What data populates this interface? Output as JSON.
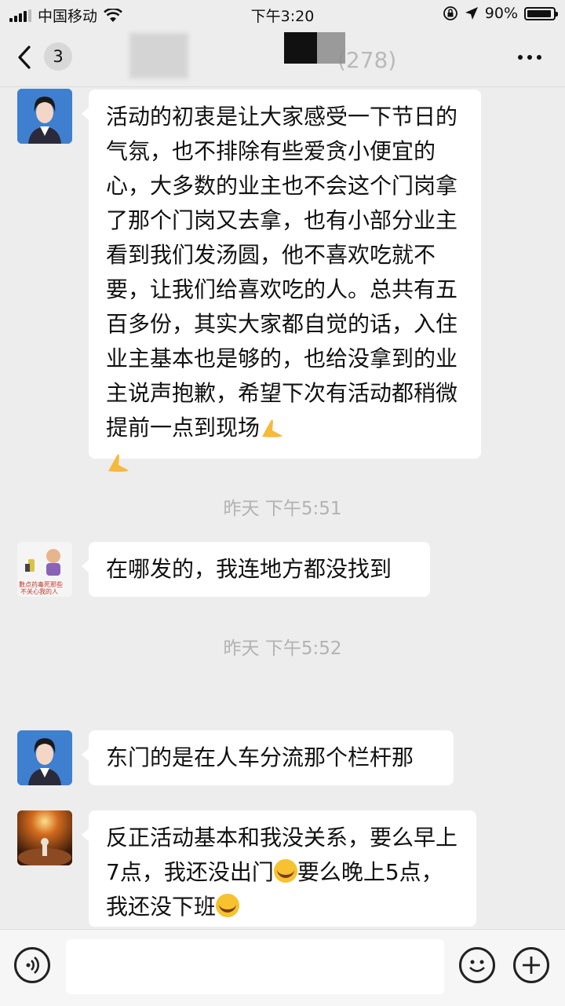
{
  "status_bar": {
    "carrier": "中国移动",
    "time": "下午3:20",
    "battery": "90%"
  },
  "nav": {
    "unread_count": "3",
    "title": "(278)"
  },
  "messages": [
    {
      "text": "活动的初衷是让大家感受一下节日的气氛，也不排除有些爱贪小便宜的心，大多数的业主也不会这个门岗拿了那个门岗又去拿，也有小部分业主看到我们发汤圆，他不喜欢吃就不要，让我们给喜欢吃的人。总共有五百多份，其实大家都自觉的话，入住业主基本也是够的，也给没拿到的业主说声抱歉，希望下次有活动都稍微提前一点到现场"
    },
    {
      "text": "在哪发的，我连地方都没找到",
      "avatar_caption_1": "數点药毒死那些",
      "avatar_caption_2": "不关心我的人"
    },
    {
      "text": "东门的是在人车分流那个栏杆那"
    },
    {
      "text_part1": "反正活动基本和我没关系，要么早上7点，我还没出门",
      "text_part2": "要么晚上5点，我还没下班"
    }
  ],
  "timestamps": [
    "昨天 下午5:51",
    "昨天 下午5:52"
  ],
  "icons": [
    "back-chevron-icon",
    "more-dots-icon",
    "voice-icon",
    "emoji-icon",
    "plus-icon",
    "wifi-icon",
    "location-arrow-icon",
    "lock-rotation-icon"
  ]
}
